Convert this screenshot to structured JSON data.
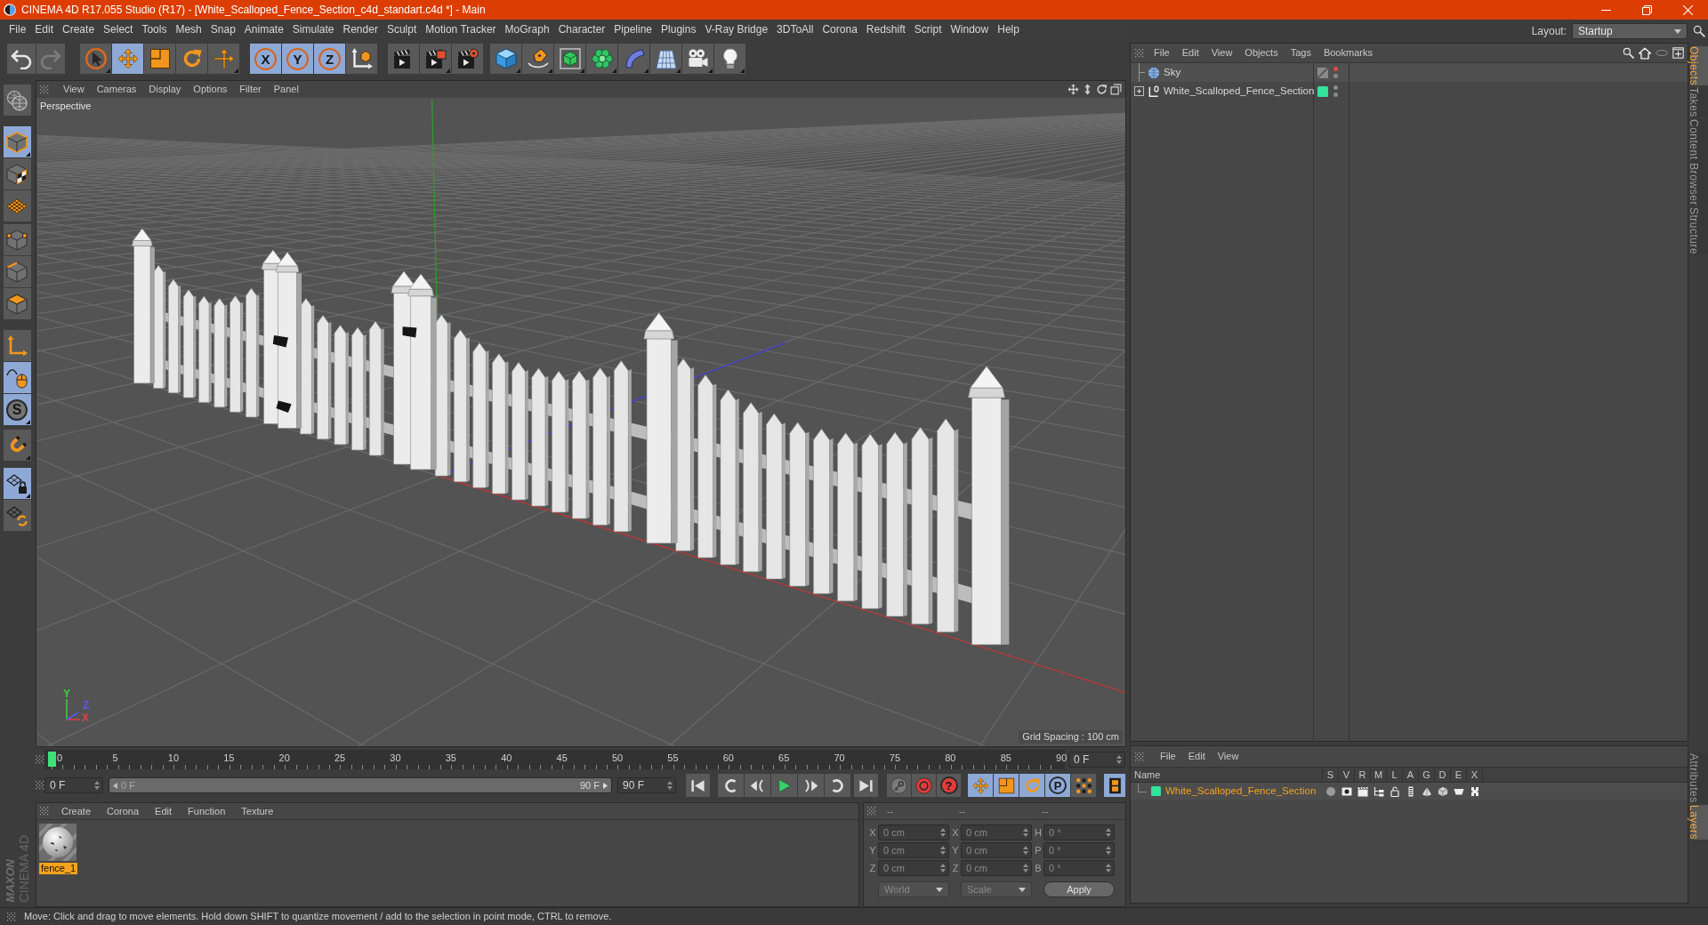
{
  "window": {
    "title": "CINEMA 4D R17.055 Studio (R17) - [White_Scalloped_Fence_Section_c4d_standart.c4d *] - Main"
  },
  "menu": [
    "File",
    "Edit",
    "Create",
    "Select",
    "Tools",
    "Mesh",
    "Snap",
    "Animate",
    "Simulate",
    "Render",
    "Sculpt",
    "Motion Tracker",
    "MoGraph",
    "Character",
    "Pipeline",
    "Plugins",
    "V-Ray Bridge",
    "3DToAll",
    "Corona",
    "Redshift",
    "Script",
    "Window",
    "Help"
  ],
  "layout": {
    "label": "Layout:",
    "value": "Startup"
  },
  "toolbar": [
    [
      {
        "kind": "undo",
        "disabled": false
      },
      {
        "kind": "redo",
        "disabled": true
      }
    ],
    [
      {
        "kind": "select",
        "selected": false
      },
      {
        "kind": "move",
        "selected": true
      },
      {
        "kind": "scale",
        "selected": false
      },
      {
        "kind": "rotate",
        "selected": false
      }
    ],
    [
      {
        "kind": "transform",
        "selected": false
      }
    ],
    [
      {
        "kind": "axis",
        "label": "X",
        "selected": true
      },
      {
        "kind": "axis",
        "label": "Y",
        "selected": true
      },
      {
        "kind": "axis",
        "label": "Z",
        "selected": true
      },
      {
        "kind": "coords",
        "selected": false
      }
    ],
    [
      {
        "kind": "render-view",
        "selected": false
      },
      {
        "kind": "render-picture",
        "selected": false
      },
      {
        "kind": "render-settings",
        "selected": false
      }
    ],
    [
      {
        "kind": "cube",
        "selected": false
      },
      {
        "kind": "pen",
        "selected": false
      },
      {
        "kind": "subdivision",
        "selected": false
      },
      {
        "kind": "cloner",
        "selected": false
      },
      {
        "kind": "bend",
        "selected": false
      },
      {
        "kind": "floor",
        "selected": false
      },
      {
        "kind": "camera",
        "selected": false
      },
      {
        "kind": "light",
        "selected": false
      }
    ]
  ],
  "modes": [
    [
      {
        "kind": "make-editable",
        "selected": false
      }
    ],
    [
      {
        "kind": "model",
        "selected": true
      },
      {
        "kind": "texture",
        "selected": false
      },
      {
        "kind": "workplane",
        "selected": false
      }
    ],
    [
      {
        "kind": "points",
        "selected": false
      },
      {
        "kind": "edges",
        "selected": false
      },
      {
        "kind": "polygons",
        "selected": false
      }
    ],
    [
      {
        "kind": "axis-mode",
        "selected": false
      },
      {
        "kind": "tweak",
        "selected": true
      },
      {
        "kind": "solo",
        "label": "S",
        "selected": true
      }
    ],
    [
      {
        "kind": "snap",
        "selected": false
      }
    ],
    [
      {
        "kind": "workplane-lock",
        "selected": true
      },
      {
        "kind": "workplane-align",
        "selected": false
      }
    ]
  ],
  "brand": {
    "maker": "MAXON",
    "product": "CINEMA 4D"
  },
  "viewport": {
    "menu": [
      "View",
      "Cameras",
      "Display",
      "Options",
      "Filter",
      "Panel"
    ],
    "camera": "Perspective",
    "gizmo_axes": [
      "Y",
      "Z",
      "X"
    ],
    "grid_spacing": "Grid Spacing : 100 cm"
  },
  "timeline": {
    "ticks": [
      "0",
      "5",
      "10",
      "15",
      "20",
      "25",
      "30",
      "35",
      "40",
      "45",
      "50",
      "55",
      "60",
      "65",
      "70",
      "75",
      "80",
      "85",
      "90"
    ],
    "level": 0,
    "current": "0 F",
    "start": "0 F",
    "range": {
      "start": "0 F",
      "end": "90 F",
      "level": 1
    },
    "end": "90 F"
  },
  "transport": [
    [
      {
        "kind": "first"
      }
    ],
    [
      {
        "kind": "prev-key"
      },
      {
        "kind": "prev-frame"
      },
      {
        "kind": "play"
      },
      {
        "kind": "next-frame"
      },
      {
        "kind": "next-key"
      }
    ],
    [
      {
        "kind": "last"
      }
    ]
  ],
  "key_tools": [
    [
      {
        "kind": "key",
        "selected": false
      },
      {
        "kind": "record",
        "selected": false
      },
      {
        "kind": "autokey",
        "label": "?",
        "selected": false
      }
    ],
    [
      {
        "kind": "key-move",
        "selected": true
      },
      {
        "kind": "key-scale",
        "selected": true
      },
      {
        "kind": "key-rotate",
        "selected": true
      },
      {
        "kind": "key-param",
        "label": "P",
        "selected": true
      },
      {
        "kind": "key-points",
        "selected": false
      }
    ],
    [
      {
        "kind": "timeline",
        "selected": true
      }
    ]
  ],
  "materials": {
    "menu": [
      "Create",
      "Corona",
      "Edit",
      "Function",
      "Texture"
    ],
    "items": [
      {
        "name": "fence_1",
        "selected": true
      }
    ]
  },
  "coordinates": {
    "headers": [
      "--",
      "--",
      "--"
    ],
    "rows": [
      [
        {
          "label": "X",
          "value": "0 cm"
        },
        {
          "label": "X",
          "value": "0 cm"
        },
        {
          "label": "H",
          "value": "0 °"
        }
      ],
      [
        {
          "label": "Y",
          "value": "0 cm"
        },
        {
          "label": "Y",
          "value": "0 cm"
        },
        {
          "label": "P",
          "value": "0 °"
        }
      ],
      [
        {
          "label": "Z",
          "value": "0 cm"
        },
        {
          "label": "Z",
          "value": "0 cm"
        },
        {
          "label": "B",
          "value": "0 °"
        }
      ]
    ],
    "dropdowns": [
      "World",
      "Scale"
    ],
    "apply": "Apply"
  },
  "objects": {
    "menu": [
      "File",
      "Edit",
      "View",
      "Objects",
      "Tags",
      "Bookmarks"
    ],
    "items": [
      {
        "name": "Sky",
        "kind": "sky",
        "editor_hidden": true,
        "render_hidden": false
      },
      {
        "name": "White_Scalloped_Fence_Section",
        "kind": "null",
        "expanded": false,
        "color": "#33e39a",
        "editor_hidden": false,
        "render_hidden": false
      }
    ]
  },
  "layers": {
    "menu": [
      "File",
      "Edit",
      "View"
    ],
    "columns": [
      "Name",
      "S",
      "V",
      "R",
      "M",
      "L",
      "A",
      "G",
      "D",
      "E",
      "X"
    ],
    "items": [
      {
        "name": "White_Scalloped_Fence_Section",
        "color": "#33e39a"
      }
    ]
  },
  "side_tabs": {
    "top": [
      {
        "label": "Objects",
        "selected": true
      },
      {
        "label": "Takes",
        "selected": false
      },
      {
        "label": "Content Browser",
        "selected": false
      },
      {
        "label": "Structure",
        "selected": false
      }
    ],
    "bottom": [
      {
        "label": "Attributes",
        "selected": false
      },
      {
        "label": "Layers",
        "selected": true
      }
    ]
  },
  "status_bar": "Move: Click and drag to move elements. Hold down SHIFT to quantize movement / add to the selection in point mode, CTRL to remove."
}
